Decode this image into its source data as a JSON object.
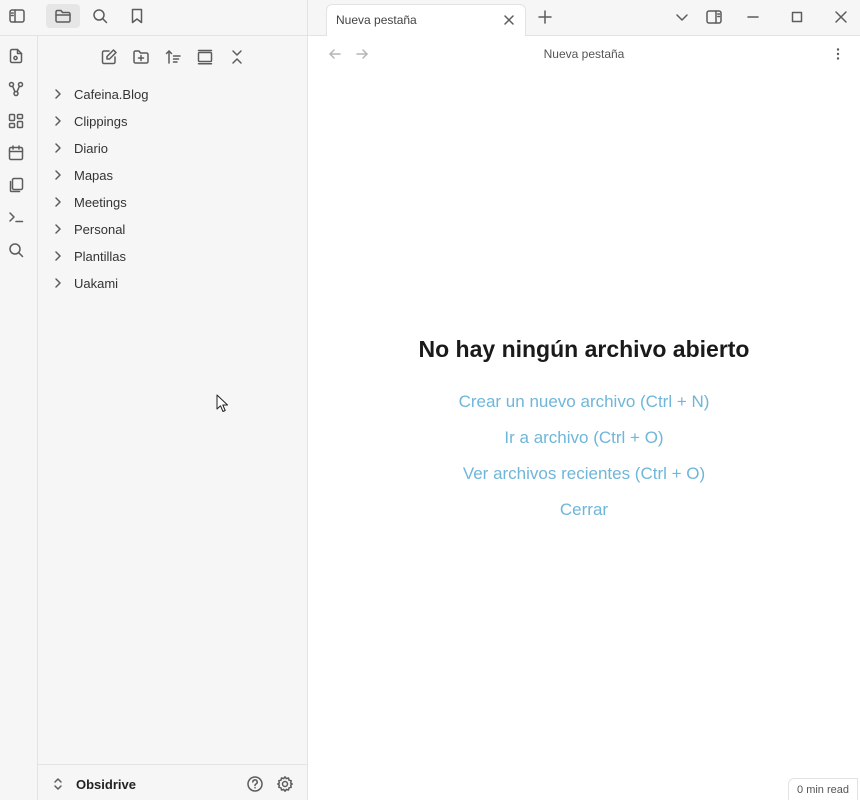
{
  "topbar": {
    "icons": [
      "sidebar-toggle-icon",
      "folder-icon",
      "search-icon",
      "bookmark-icon"
    ]
  },
  "ribbon": {
    "icons": [
      "file-edit-icon",
      "graph-icon",
      "layout-grid-icon",
      "calendar-icon",
      "copy-files-icon",
      "terminal-icon",
      "search-icon"
    ]
  },
  "file_explorer": {
    "action_icons": [
      "new-note-icon",
      "new-folder-icon",
      "sort-icon",
      "auto-reveal-icon",
      "collapse-all-icon"
    ],
    "folders": [
      {
        "label": "Cafeina.Blog"
      },
      {
        "label": "Clippings"
      },
      {
        "label": "Diario"
      },
      {
        "label": "Mapas"
      },
      {
        "label": "Meetings"
      },
      {
        "label": "Personal"
      },
      {
        "label": "Plantillas"
      },
      {
        "label": "Uakami"
      }
    ]
  },
  "vault": {
    "name": "Obsidrive"
  },
  "tabs": [
    {
      "title": "Nueva pestaña",
      "active": true
    }
  ],
  "view": {
    "title": "Nueva pestaña"
  },
  "empty_state": {
    "title": "No hay ningún archivo abierto",
    "actions": [
      {
        "label": "Crear un nuevo archivo (Ctrl + N)"
      },
      {
        "label": "Ir a archivo (Ctrl + O)"
      },
      {
        "label": "Ver archivos recientes (Ctrl + O)"
      },
      {
        "label": "Cerrar"
      }
    ]
  },
  "statusbar": {
    "word_count": "0 min read"
  },
  "colors": {
    "link": "#6fb6d9",
    "sidebar_bg": "#f6f6f6",
    "border": "#e3e3e3"
  }
}
